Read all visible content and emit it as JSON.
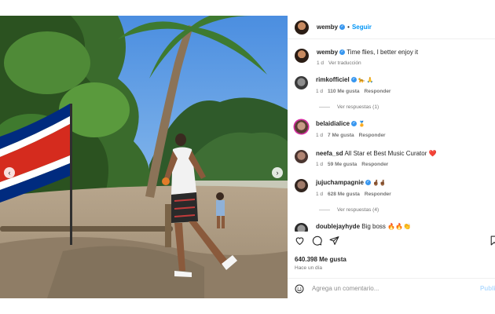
{
  "post": {
    "author": "wemby",
    "follow_label": "Seguir",
    "separator": "•"
  },
  "caption": {
    "user": "wemby",
    "text": "Time flies, I better enjoy it",
    "time": "1 d",
    "translate_label": "Ver traducción"
  },
  "comments": [
    {
      "user": "rimkofficiel",
      "text": "🐆 🙏",
      "time": "1 d",
      "likes": "110 Me gusta",
      "reply_label": "Responder",
      "view_replies": "Ver respuestas (1)"
    },
    {
      "user": "belaidialice",
      "text": "🏅",
      "time": "1 d",
      "likes": "7 Me gusta",
      "reply_label": "Responder"
    },
    {
      "user": "neefa_sd",
      "text": "All Star et Best Music Curator ❤️",
      "time": "1 d",
      "likes": "59 Me gusta",
      "reply_label": "Responder"
    },
    {
      "user": "jujuchampagnie",
      "text": "🤞🏾🤞🏾",
      "time": "1 d",
      "likes": "628 Me gusta",
      "reply_label": "Responder",
      "view_replies": "Ver respuestas (4)"
    },
    {
      "user": "doublejayhyde",
      "text": "Big boss 🔥🔥👏"
    }
  ],
  "stats": {
    "likes": "640.398 Me gusta",
    "posted": "Hace un día"
  },
  "composer": {
    "placeholder": "Agrega un comentario...",
    "publish_label": "Publi"
  },
  "carousel": {
    "prev_icon": "chevron-left-icon",
    "next_icon": "chevron-right-icon"
  },
  "colors": {
    "verified": "#3897f0",
    "link": "#0095f6",
    "flag_red": "#d52b1e",
    "flag_blue": "#002b7f"
  }
}
